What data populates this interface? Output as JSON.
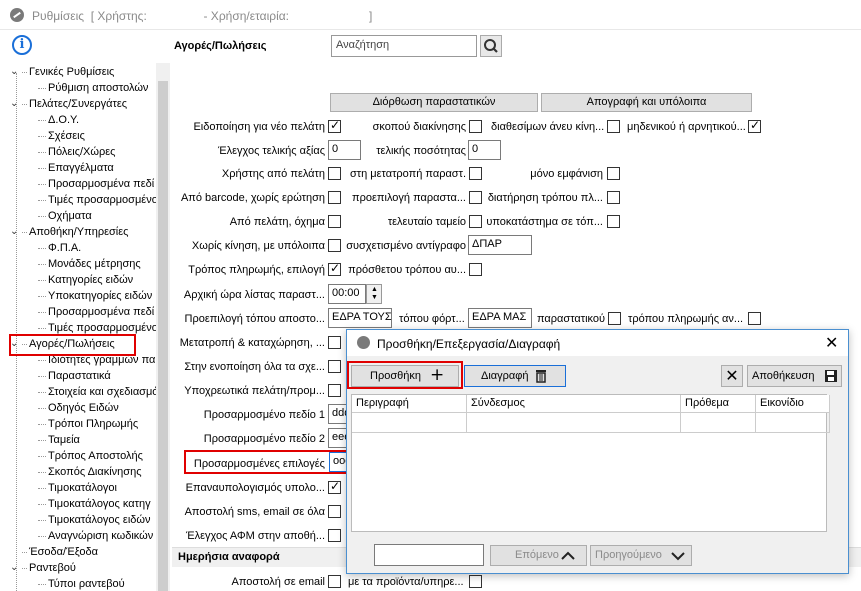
{
  "window": {
    "title_text": "Ρυθμίσεις  [ Χρήστης:                 - Χρήση/εταιρία:                        ]"
  },
  "tree": {
    "items": [
      {
        "label": "Γενικές Ρυθμίσεις",
        "level": 0,
        "expanded": true
      },
      {
        "label": "Ρύθμιση αποστολών",
        "level": 1
      },
      {
        "label": "Πελάτες/Συνεργάτες",
        "level": 0,
        "expanded": true
      },
      {
        "label": "Δ.Ο.Υ.",
        "level": 1
      },
      {
        "label": "Σχέσεις",
        "level": 1
      },
      {
        "label": "Πόλεις/Χώρες",
        "level": 1
      },
      {
        "label": "Επαγγέλματα",
        "level": 1
      },
      {
        "label": "Προσαρμοσμένα πεδί",
        "level": 1
      },
      {
        "label": "Τιμές προσαρμοσμένο",
        "level": 1
      },
      {
        "label": "Οχήματα",
        "level": 1
      },
      {
        "label": "Αποθήκη/Υπηρεσίες",
        "level": 0,
        "expanded": true
      },
      {
        "label": "Φ.Π.Α.",
        "level": 1
      },
      {
        "label": "Μονάδες μέτρησης",
        "level": 1
      },
      {
        "label": "Κατηγορίες ειδών",
        "level": 1
      },
      {
        "label": "Υποκατηγορίες ειδών",
        "level": 1
      },
      {
        "label": "Προσαρμοσμένα πεδί",
        "level": 1
      },
      {
        "label": "Τιμές προσαρμοσμένο",
        "level": 1
      },
      {
        "label": "Αγορές/Πωλήσεις",
        "level": 0,
        "expanded": true,
        "selected": true
      },
      {
        "label": "Ιδιότητες γραμμών πα",
        "level": 1
      },
      {
        "label": "Παραστατικά",
        "level": 1
      },
      {
        "label": "Στοιχεία και σχεδιασμό",
        "level": 1
      },
      {
        "label": "Οδηγός Ειδών",
        "level": 1
      },
      {
        "label": "Τρόποι Πληρωμής",
        "level": 1
      },
      {
        "label": "Ταμεία",
        "level": 1
      },
      {
        "label": "Τρόπος Αποστολής",
        "level": 1
      },
      {
        "label": "Σκοπός Διακίνησης",
        "level": 1
      },
      {
        "label": "Τιμοκατάλογοι",
        "level": 1
      },
      {
        "label": "Τιμοκατάλογος κατηγ",
        "level": 1
      },
      {
        "label": "Τιμοκατάλογος ειδών",
        "level": 1
      },
      {
        "label": "Αναγνώριση κωδικών",
        "level": 1
      },
      {
        "label": "Έσοδα/Έξοδα",
        "level": 0
      },
      {
        "label": "Ραντεβού",
        "level": 0,
        "expanded": true
      },
      {
        "label": "Τύποι ραντεβού",
        "level": 1
      }
    ]
  },
  "header": {
    "section_title": "Αγορές/Πωλήσεις",
    "search_value": "Αναζήτηση"
  },
  "top_buttons": {
    "correction": "Διόρθωση παραστατικών",
    "stock": "Απογραφή και υπόλοιπα"
  },
  "rows": {
    "r1": {
      "l1": "Ειδοποίηση για νέο πελάτη",
      "c1": true,
      "l2": "σκοπού διακίνησης",
      "c2": false,
      "l3": "διαθεσίμων άνευ κίνη...",
      "c3": false,
      "l4": "μηδενικού ή αρνητικού...",
      "c4": true
    },
    "r2": {
      "l1": "Έλεγχος τελικής αξίας",
      "v1": "0",
      "l2": "τελικής ποσότητας",
      "v2": "0"
    },
    "r3": {
      "l1": "Χρήστης από πελάτη",
      "c1": false,
      "l2": "στη μετατροπή παραστ.",
      "c2": false,
      "l3": "μόνο εμφάνιση",
      "c3": false
    },
    "r4": {
      "l1": "Από barcode, χωρίς ερώτηση",
      "c1": false,
      "l2": "προεπιλογή παραστα...",
      "c2": false,
      "l3": "διατήρηση τρόπου πλ...",
      "c3": false
    },
    "r5": {
      "l1": "Από πελάτη, όχημα",
      "c1": false,
      "l2": "τελευταίο ταμείο",
      "c2": false,
      "l3": "υποκατάστημα σε τόπ...",
      "c3": false
    },
    "r6": {
      "l1": "Χωρίς κίνηση, με υπόλοιπα",
      "c1": false,
      "l2": "συσχετισμένο αντίγραφο",
      "v2": "ΔΠΑΡ"
    },
    "r7": {
      "l1": "Τρόπος πληρωμής, επιλογή",
      "c1": true,
      "l2": "πρόσθετου τρόπου αυ...",
      "c2": false
    },
    "r8": {
      "l1": "Αρχική ώρα λίστας παραστ...",
      "v1": "00:00"
    },
    "r9": {
      "l1": "Προεπιλογή τόπου αποστο...",
      "v1": "ΕΔΡΑ ΤΟΥΣ",
      "l2": "τόπου φόρτ...",
      "v2": "ΕΔΡΑ ΜΑΣ",
      "l3": "παραστατικού",
      "c3": false,
      "l4": "τρόπου πληρωμής αν...",
      "c4": false
    },
    "r10": {
      "l1": "Μετατροπή & καταχώρηση, ..."
    },
    "r11": {
      "l1": "Στην ενοποίηση όλα τα σχε..."
    },
    "r12": {
      "l1": "Υποχρεωτικά πελάτη/προμ..."
    },
    "r13": {
      "l1": "Προσαρμοσμένο πεδίο 1",
      "v1": "ddd"
    },
    "r14": {
      "l1": "Προσαρμοσμένο πεδίο 2",
      "v1": "eee"
    },
    "r15": {
      "l1": "Προσαρμοσμένες επιλογές",
      "v1": "ooo"
    },
    "r16": {
      "l1": "Επαναυπολογισμός υπολο...",
      "c1": true
    },
    "r17": {
      "l1": "Αποστολή sms, email σε όλα",
      "c1": false
    },
    "r18": {
      "l1": "Έλεγχος ΑΦΜ στην αποθή...",
      "c1": false
    }
  },
  "daily_report": {
    "section_title": "Ημερήσια αναφορά",
    "l1": "Αποστολή σε email",
    "c1": false,
    "l2": "με τα προϊόντα/υπηρε...",
    "c2": false
  },
  "dialog": {
    "title": "Προσθήκη/Επεξεργασία/Διαγραφή",
    "add_label": "Προσθήκη",
    "delete_label": "Διαγραφή",
    "save_label": "Αποθήκευση",
    "columns": [
      "Περιγραφή",
      "Σύνδεσμος",
      "Πρόθεμα",
      "Εικονίδιο"
    ],
    "search_value": "",
    "next_label": "Επόμενο",
    "prev_label": "Προηγούμενο"
  },
  "colors": {
    "highlight": "#e00000",
    "dialog_border": "#4a8fd0",
    "info_blue": "#1a6fd8"
  }
}
